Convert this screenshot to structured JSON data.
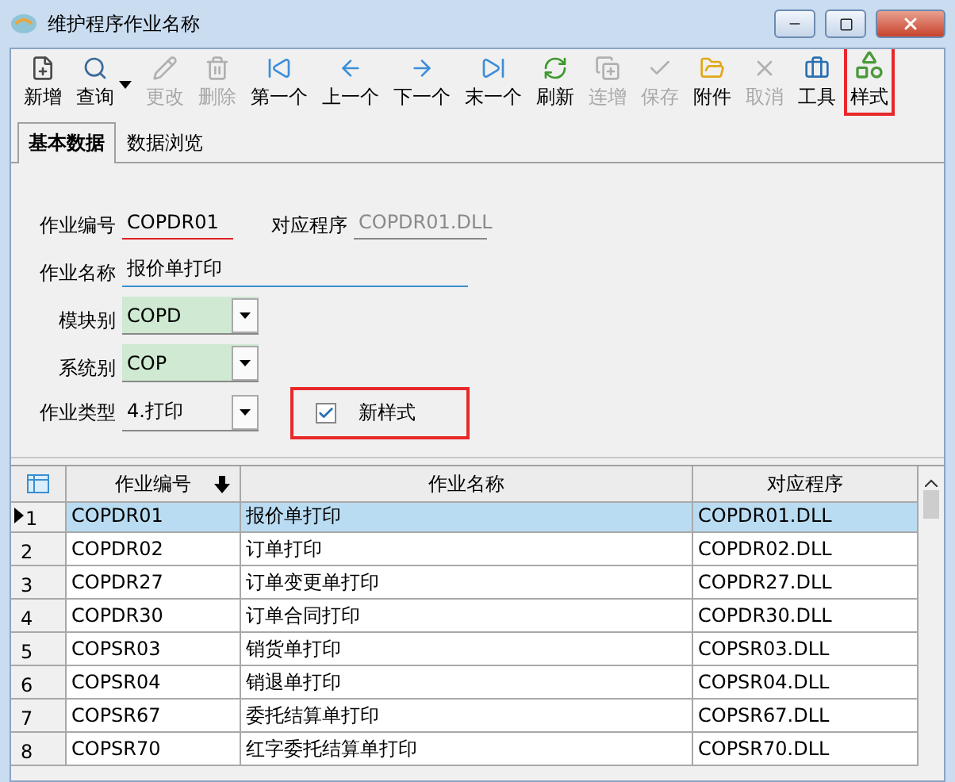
{
  "window": {
    "title": "维护程序作业名称"
  },
  "toolbar": [
    {
      "label": "新增",
      "kind": "new",
      "disabled": false,
      "highlighted": false,
      "dropdown": false
    },
    {
      "label": "查询",
      "kind": "search",
      "disabled": false,
      "highlighted": false,
      "dropdown": true
    },
    {
      "label": "更改",
      "kind": "edit",
      "disabled": true,
      "highlighted": false,
      "dropdown": false
    },
    {
      "label": "删除",
      "kind": "delete",
      "disabled": true,
      "highlighted": false,
      "dropdown": false
    },
    {
      "label": "第一个",
      "kind": "first",
      "disabled": false,
      "highlighted": false,
      "dropdown": false
    },
    {
      "label": "上一个",
      "kind": "prev",
      "disabled": false,
      "highlighted": false,
      "dropdown": false
    },
    {
      "label": "下一个",
      "kind": "next",
      "disabled": false,
      "highlighted": false,
      "dropdown": false
    },
    {
      "label": "末一个",
      "kind": "last",
      "disabled": false,
      "highlighted": false,
      "dropdown": false
    },
    {
      "label": "刷新",
      "kind": "refresh",
      "disabled": false,
      "highlighted": false,
      "dropdown": false
    },
    {
      "label": "连增",
      "kind": "copy",
      "disabled": true,
      "highlighted": false,
      "dropdown": false
    },
    {
      "label": "保存",
      "kind": "save",
      "disabled": true,
      "highlighted": false,
      "dropdown": false
    },
    {
      "label": "附件",
      "kind": "folder",
      "disabled": false,
      "highlighted": false,
      "dropdown": false
    },
    {
      "label": "取消",
      "kind": "cancel",
      "disabled": true,
      "highlighted": false,
      "dropdown": false
    },
    {
      "label": "工具",
      "kind": "tools",
      "disabled": false,
      "highlighted": false,
      "dropdown": false
    },
    {
      "label": "样式",
      "kind": "style",
      "disabled": false,
      "highlighted": true,
      "dropdown": false
    }
  ],
  "tabs": [
    {
      "label": "基本数据",
      "selected": true
    },
    {
      "label": "数据浏览",
      "selected": false
    }
  ],
  "form": {
    "job_no": {
      "label": "作业编号",
      "value": "COPDR01"
    },
    "program": {
      "label": "对应程序",
      "value": "COPDR01.DLL"
    },
    "job_name": {
      "label": "作业名称",
      "value": "报价单打印"
    },
    "module": {
      "label": "模块别",
      "value": "COPD"
    },
    "system": {
      "label": "系统别",
      "value": "COP"
    },
    "job_type": {
      "label": "作业类型",
      "value": "4.打印"
    },
    "new_style": {
      "label": "新样式",
      "checked": true,
      "highlighted": true
    }
  },
  "table": {
    "columns": [
      "作业编号",
      "作业名称",
      "对应程序"
    ],
    "rows": [
      {
        "num": "1",
        "cells": [
          "COPDR01",
          "报价单打印",
          "COPDR01.DLL"
        ],
        "selected": true
      },
      {
        "num": "2",
        "cells": [
          "COPDR02",
          "订单打印",
          "COPDR02.DLL"
        ],
        "selected": false
      },
      {
        "num": "3",
        "cells": [
          "COPDR27",
          "订单变更单打印",
          "COPDR27.DLL"
        ],
        "selected": false
      },
      {
        "num": "4",
        "cells": [
          "COPDR30",
          "订单合同打印",
          "COPDR30.DLL"
        ],
        "selected": false
      },
      {
        "num": "5",
        "cells": [
          "COPSR03",
          "销货单打印",
          "COPSR03.DLL"
        ],
        "selected": false
      },
      {
        "num": "6",
        "cells": [
          "COPSR04",
          "销退单打印",
          "COPSR04.DLL"
        ],
        "selected": false
      },
      {
        "num": "7",
        "cells": [
          "COPSR67",
          "委托结算单打印",
          "COPSR67.DLL"
        ],
        "selected": false
      },
      {
        "num": "8",
        "cells": [
          "COPSR70",
          "红字委托结算单打印",
          "COPSR70.DLL"
        ],
        "selected": false
      }
    ]
  }
}
